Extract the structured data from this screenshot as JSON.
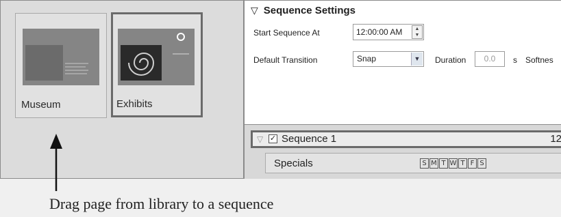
{
  "library": {
    "pages": [
      {
        "label": "Museum"
      },
      {
        "label": "Exhibits"
      }
    ]
  },
  "sequence_settings": {
    "title": "Sequence Settings",
    "start_label": "Start Sequence At",
    "start_value": "12:00:00 AM",
    "transition_label": "Default Transition",
    "transition_value": "Snap",
    "duration_label": "Duration",
    "duration_value": "0.0",
    "duration_unit": "s",
    "softness_label": "Softnes"
  },
  "sequence_list": {
    "sequence_name": "Sequence 1",
    "sequence_time": "12",
    "page_name": "Specials",
    "days": [
      "S",
      "M",
      "T",
      "W",
      "T",
      "F",
      "S"
    ]
  },
  "annotation": {
    "caption": "Drag page from library to a sequence"
  },
  "colors": {
    "panel_bg": "#dcdcdc",
    "selected_border": "#6a6a6a",
    "thumb_gray": "#858585"
  }
}
